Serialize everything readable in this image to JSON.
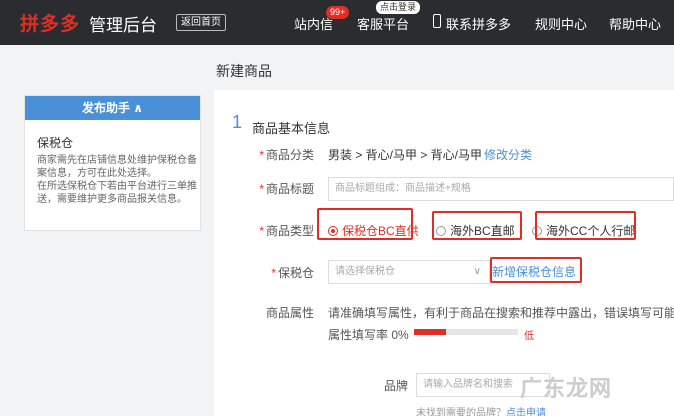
{
  "header": {
    "brand": "拼多多",
    "brand_sub": "管理后台",
    "back_label": "返回首页",
    "nav": {
      "messages": "站内信",
      "messages_badge": "99+",
      "service": "客服平台",
      "service_tip": "点击登录",
      "contact": "联系拼多多",
      "rules": "规则中心",
      "help": "帮助中心"
    }
  },
  "page": {
    "title": "新建商品"
  },
  "assistant": {
    "header": "发布助手 ∧",
    "title": "保税仓",
    "desc": "商家需先在店铺信息处维护保税仓备案信息，方可在此处选择。\n在所选保税仓下若由平台进行三单推送，需要维护更多商品报关信息。"
  },
  "form": {
    "section_number": "1",
    "section_title": "商品基本信息",
    "category": {
      "label": "商品分类",
      "value": "男装 > 背心/马甲 > 背心/马甲",
      "edit": "修改分类"
    },
    "product_title": {
      "label": "商品标题",
      "placeholder": "商品标题组成：商品描述+规格"
    },
    "product_type": {
      "label": "商品类型",
      "options": [
        "保税仓BC直供",
        "海外BC直邮",
        "海外CC个人行邮"
      ]
    },
    "warehouse": {
      "label": "保税仓",
      "placeholder": "请选择保税仓",
      "add": "新增保税仓信息"
    },
    "attributes": {
      "label": "商品属性",
      "hint": "请准确填写属性，有利于商品在搜索和推荐中露出，错误填写可能面临",
      "rate_label": "属性填写率 0%",
      "rate": 0,
      "level": "低"
    },
    "brand": {
      "label": "品牌",
      "placeholder": "请输入品牌名和搜索",
      "note": "未找到需要的品牌？",
      "apply": "点击申请"
    }
  },
  "watermark": "广东龙网"
}
